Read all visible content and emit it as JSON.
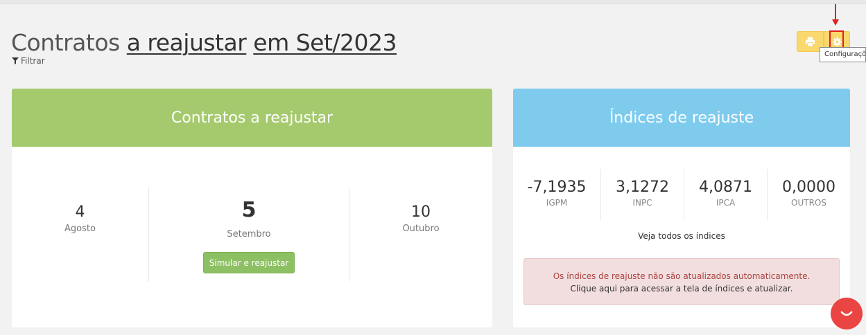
{
  "header": {
    "title_prefix": "Contratos",
    "title_link1": "a reajustar",
    "title_link2": "em Set/2023",
    "filter_label": "Filtrar"
  },
  "toolbar": {
    "print_icon": "printer-icon",
    "settings_icon": "gear-icon",
    "tooltip": "Configurações"
  },
  "contracts_card": {
    "title": "Contratos a reajustar",
    "months": [
      {
        "count": "4",
        "label": "Agosto"
      },
      {
        "count": "5",
        "label": "Setembro"
      },
      {
        "count": "10",
        "label": "Outubro"
      }
    ],
    "simulate_label": "Simular e reajustar"
  },
  "indices_card": {
    "title": "Índices de reajuste",
    "indices": [
      {
        "value": "-7,1935",
        "label": "IGPM"
      },
      {
        "value": "3,1272",
        "label": "INPC"
      },
      {
        "value": "4,0871",
        "label": "IPCA"
      },
      {
        "value": "0,0000",
        "label": "OUTROS"
      }
    ],
    "see_all": "Veja todos os índices",
    "alert_line1": "Os índices de reajuste não são atualizados automaticamente.",
    "alert_line2": "Clique aqui para acessar a tela de índices e atualizar."
  },
  "colors": {
    "green_header": "#a5ca6e",
    "blue_header": "#7ecbee",
    "yellow_button": "#f9d86e",
    "annotation_red": "#e02020",
    "chat_red": "#ea4443"
  }
}
